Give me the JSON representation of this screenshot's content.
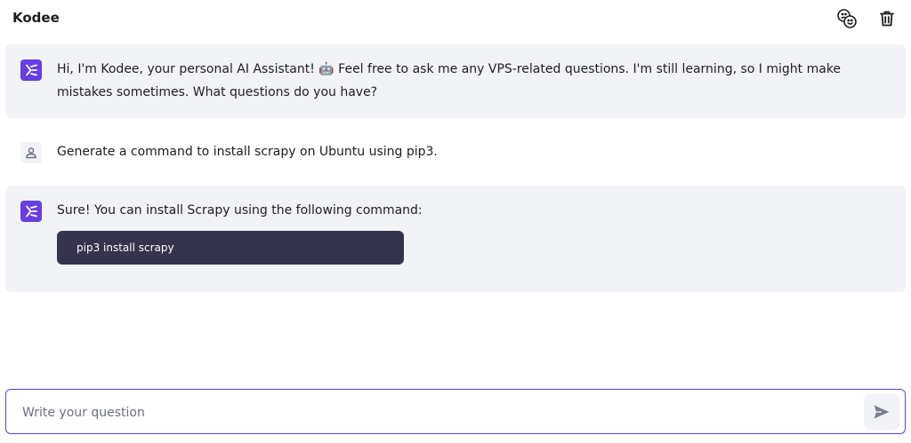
{
  "header": {
    "title": "Kodee",
    "icons": [
      "feedback-faces-icon",
      "trash-icon"
    ]
  },
  "messages": [
    {
      "role": "assistant",
      "text": "Hi, I'm Kodee, your personal AI Assistant! 🤖 Feel free to ask me any VPS-related questions. I'm still learning, so I might make mistakes sometimes. What questions do you have?"
    },
    {
      "role": "user",
      "text": "Generate a command to install scrapy on Ubuntu using pip3."
    },
    {
      "role": "assistant",
      "text": "Sure! You can install Scrapy using the following command:",
      "code": "pip3 install scrapy"
    }
  ],
  "composer": {
    "placeholder": "Write your question",
    "value": ""
  },
  "colors": {
    "accent": "#673de6",
    "bubble_bg": "#f2f3f6",
    "code_bg": "#36344d",
    "text": "#1d1e20"
  }
}
